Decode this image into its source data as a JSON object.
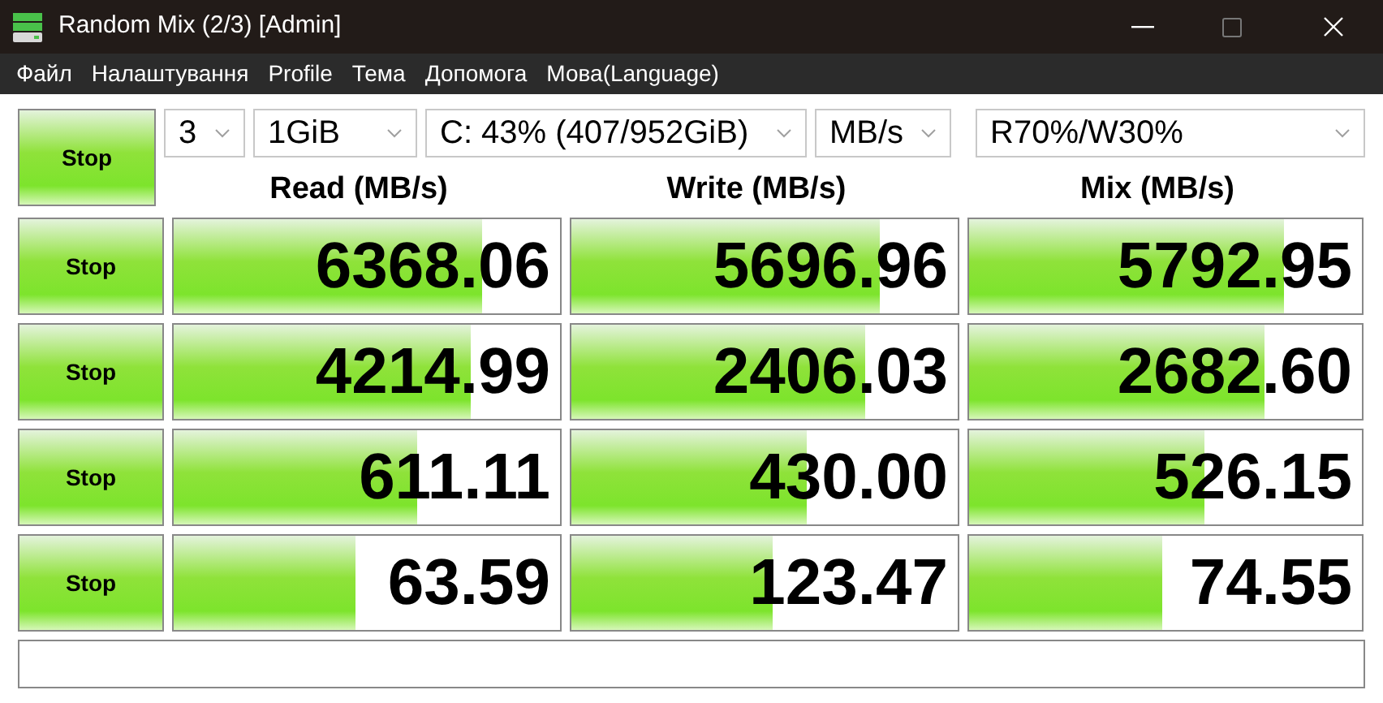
{
  "window": {
    "title": "Random Mix (2/3) [Admin]"
  },
  "menu": [
    "Файл",
    "Налаштування",
    "Profile",
    "Тема",
    "Допомога",
    "Мова(Language)"
  ],
  "controls": {
    "all_button": "Stop",
    "count": "3",
    "size": "1GiB",
    "drive": "C: 43% (407/952GiB)",
    "unit": "MB/s",
    "mix": "R70%/W30%"
  },
  "columns": [
    "Read (MB/s)",
    "Write (MB/s)",
    "Mix (MB/s)"
  ],
  "rows": [
    {
      "button": "Stop",
      "cells": [
        {
          "value": "6368.06",
          "level": 0.8
        },
        {
          "value": "5696.96",
          "level": 0.8
        },
        {
          "value": "5792.95",
          "level": 0.8
        }
      ]
    },
    {
      "button": "Stop",
      "cells": [
        {
          "value": "4214.99",
          "level": 0.77
        },
        {
          "value": "2406.03",
          "level": 0.76
        },
        {
          "value": "2682.60",
          "level": 0.75
        }
      ]
    },
    {
      "button": "Stop",
      "cells": [
        {
          "value": "611.11",
          "level": 0.63
        },
        {
          "value": "430.00",
          "level": 0.61
        },
        {
          "value": "526.15",
          "level": 0.6
        }
      ]
    },
    {
      "button": "Stop",
      "cells": [
        {
          "value": "63.59",
          "level": 0.47
        },
        {
          "value": "123.47",
          "level": 0.52
        },
        {
          "value": "74.55",
          "level": 0.49
        }
      ]
    }
  ]
}
